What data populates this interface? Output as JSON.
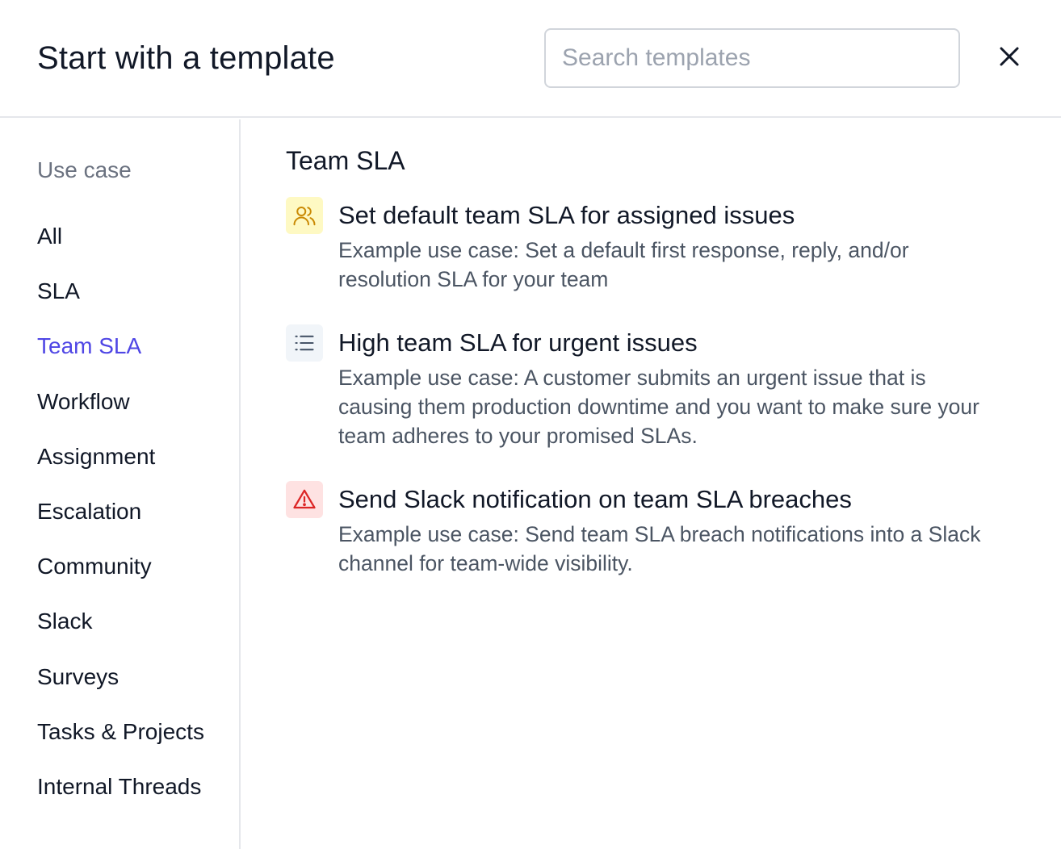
{
  "header": {
    "title": "Start with a template",
    "search_placeholder": "Search templates"
  },
  "sidebar": {
    "heading": "Use case",
    "items": [
      {
        "label": "All",
        "active": false
      },
      {
        "label": "SLA",
        "active": false
      },
      {
        "label": "Team SLA",
        "active": true
      },
      {
        "label": "Workflow",
        "active": false
      },
      {
        "label": "Assignment",
        "active": false
      },
      {
        "label": "Escalation",
        "active": false
      },
      {
        "label": "Community",
        "active": false
      },
      {
        "label": "Slack",
        "active": false
      },
      {
        "label": "Surveys",
        "active": false
      },
      {
        "label": "Tasks & Projects",
        "active": false
      },
      {
        "label": "Internal Threads",
        "active": false
      }
    ]
  },
  "main": {
    "section_title": "Team SLA",
    "templates": [
      {
        "icon": "users-icon",
        "title": "Set default team SLA for assigned issues",
        "description": "Example use case: Set a default first response, reply, and/or resolution SLA for your team"
      },
      {
        "icon": "list-icon",
        "title": "High team SLA for urgent issues",
        "description": "Example use case: A customer submits an urgent issue that is causing them production downtime and you want to make sure your team adheres to your promised SLAs."
      },
      {
        "icon": "warning-icon",
        "title": "Send Slack notification on team SLA breaches",
        "description": "Example use case: Send team SLA breach notifications into a Slack channel for team-wide visibility."
      }
    ]
  },
  "colors": {
    "accent": "#4f46e5",
    "users_icon_bg": "#fef9c3",
    "users_icon_fg": "#ca8a04",
    "list_icon_bg": "#f1f5f9",
    "list_icon_fg": "#475569",
    "warning_icon_bg": "#fee2e2",
    "warning_icon_fg": "#dc2626"
  }
}
